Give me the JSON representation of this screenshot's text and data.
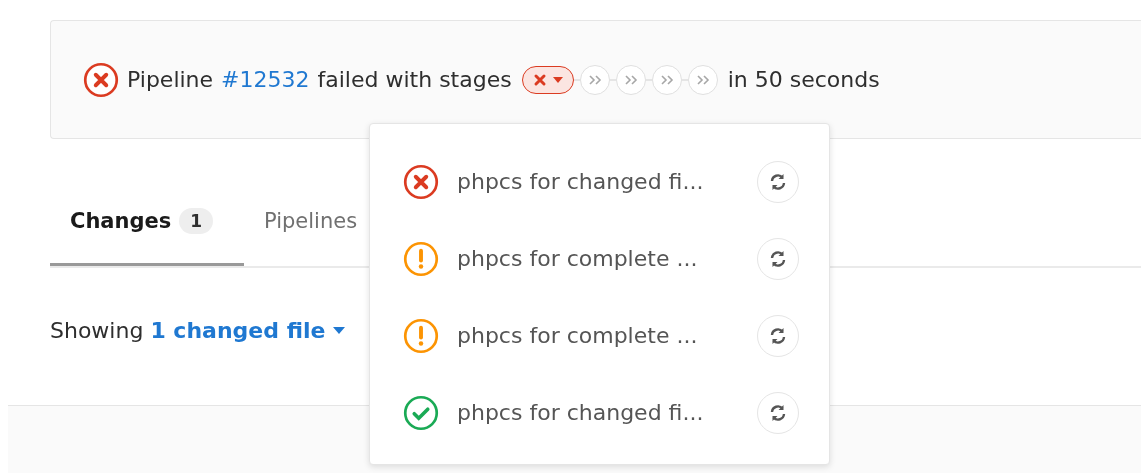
{
  "pipeline": {
    "kind": "failed",
    "label": "Pipeline",
    "link": "#12532",
    "text": "failed with stages",
    "duration": "in 50 seconds",
    "stages": [
      {
        "kind": "failed"
      },
      {
        "kind": "skipped"
      },
      {
        "kind": "skipped"
      },
      {
        "kind": "skipped"
      },
      {
        "kind": "skipped"
      }
    ]
  },
  "tabs": [
    {
      "label": "Changes",
      "count": "1",
      "selected": true
    },
    {
      "label": "Pipelines",
      "selected": false
    }
  ],
  "summary": {
    "prefix": "Showing",
    "link": "1 changed file"
  },
  "dropdown": {
    "jobs": [
      {
        "kind": "failed",
        "name": "phpcs for changed fi..."
      },
      {
        "kind": "warning",
        "name": "phpcs for complete ..."
      },
      {
        "kind": "warning",
        "name": "phpcs for complete ..."
      },
      {
        "kind": "success",
        "name": "phpcs for changed fi..."
      }
    ]
  }
}
